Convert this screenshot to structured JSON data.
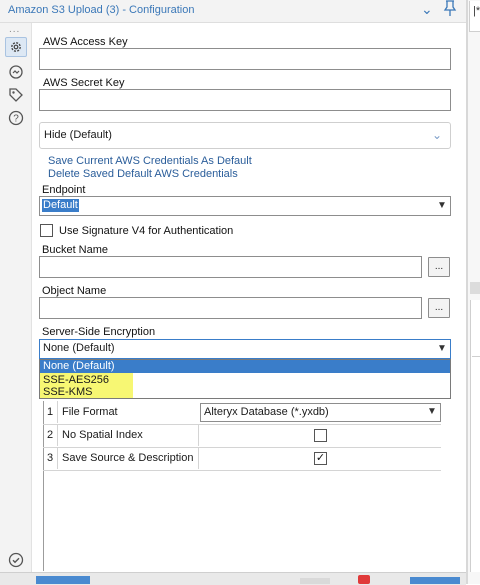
{
  "window": {
    "title": "Amazon S3 Upload (3) - Configuration",
    "pin_icon": "pin-icon",
    "chevron_icon": "chevron-down-icon"
  },
  "rail": {
    "more": "...",
    "icons": [
      "gear-icon",
      "annotation-icon",
      "tag-icon",
      "help-icon",
      "check-circle-icon"
    ]
  },
  "form": {
    "access_key_label": "AWS Access Key",
    "access_key_value": "",
    "secret_key_label": "AWS Secret Key",
    "secret_key_value": "",
    "credentials_mode": "Hide (Default)",
    "save_credentials_link": "Save Current AWS Credentials As Default",
    "delete_credentials_link": "Delete Saved Default AWS Credentials",
    "endpoint_label": "Endpoint",
    "endpoint_value": "Default",
    "sig_v4_label": "Use Signature V4 for Authentication",
    "sig_v4_checked": false,
    "bucket_label": "Bucket Name",
    "bucket_value": "",
    "browse_label": "...",
    "object_label": "Object Name",
    "object_value": "",
    "sse_label": "Server-Side Encryption",
    "sse_value": "None (Default)",
    "sse_options": [
      "None (Default)",
      "SSE-AES256",
      "SSE-KMS"
    ]
  },
  "options_table": {
    "rows": [
      {
        "num": "1",
        "name": "File Format",
        "value": "Alteryx Database (*.yxdb)"
      },
      {
        "num": "2",
        "name": "No Spatial Index",
        "checked": false
      },
      {
        "num": "3",
        "name": "Save Source & Description",
        "checked": true
      }
    ]
  },
  "colors": {
    "accent": "#3a7dc9",
    "link": "#2a5d9a",
    "highlight": "#f6f65a"
  }
}
